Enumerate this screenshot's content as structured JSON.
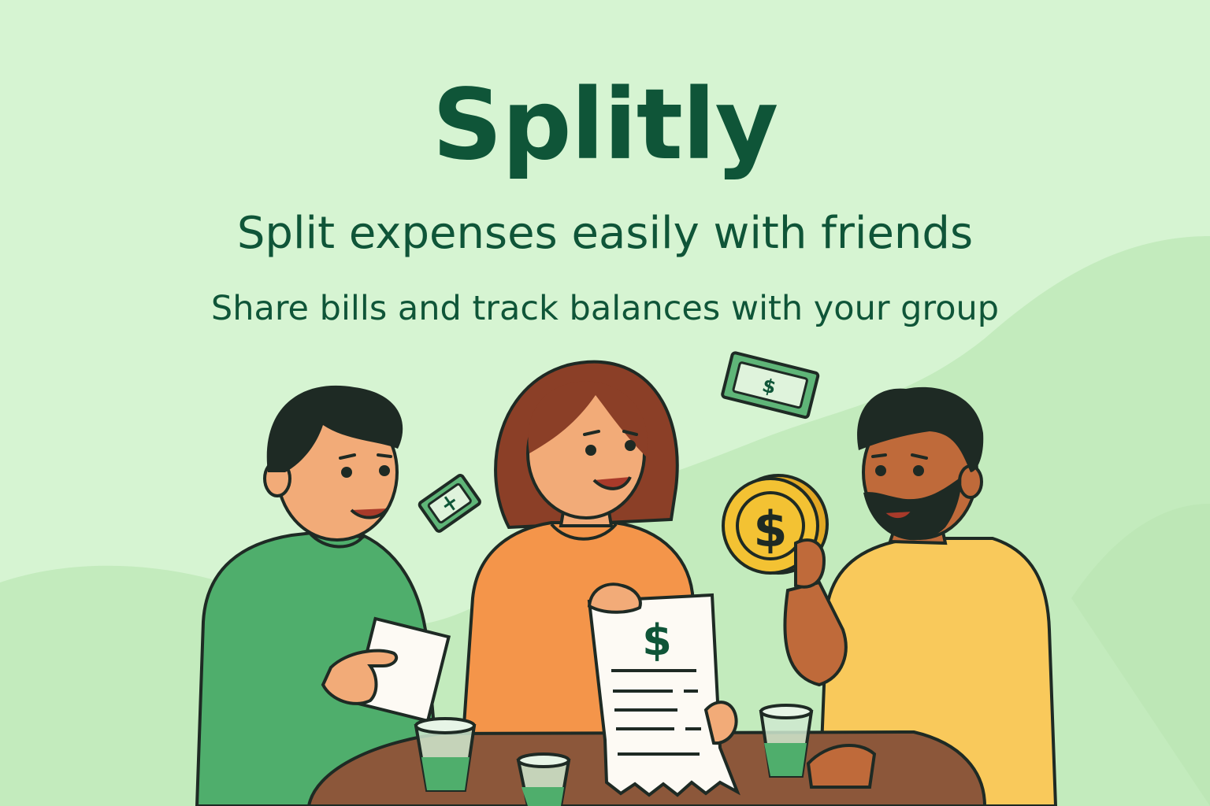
{
  "brand": {
    "name": "Splitly"
  },
  "hero": {
    "tagline": "Split expenses easily with friends",
    "subtagline": "Share bills and track balances with your group"
  },
  "illustration": {
    "receipt_symbol": "$",
    "coin_symbol": "$",
    "bill_symbol": "$",
    "icons": [
      "dollar-bill-icon",
      "gold-coin-icon",
      "receipt-icon",
      "drinking-glass-icon"
    ]
  },
  "colors": {
    "background": "#d6f4d2",
    "brand_text": "#0f5538",
    "accent_green": "#4fae6c",
    "shirt_orange": "#f4954a",
    "shirt_yellow": "#f9c95b",
    "coin_gold": "#f3c233",
    "table_brown": "#8c573a"
  }
}
